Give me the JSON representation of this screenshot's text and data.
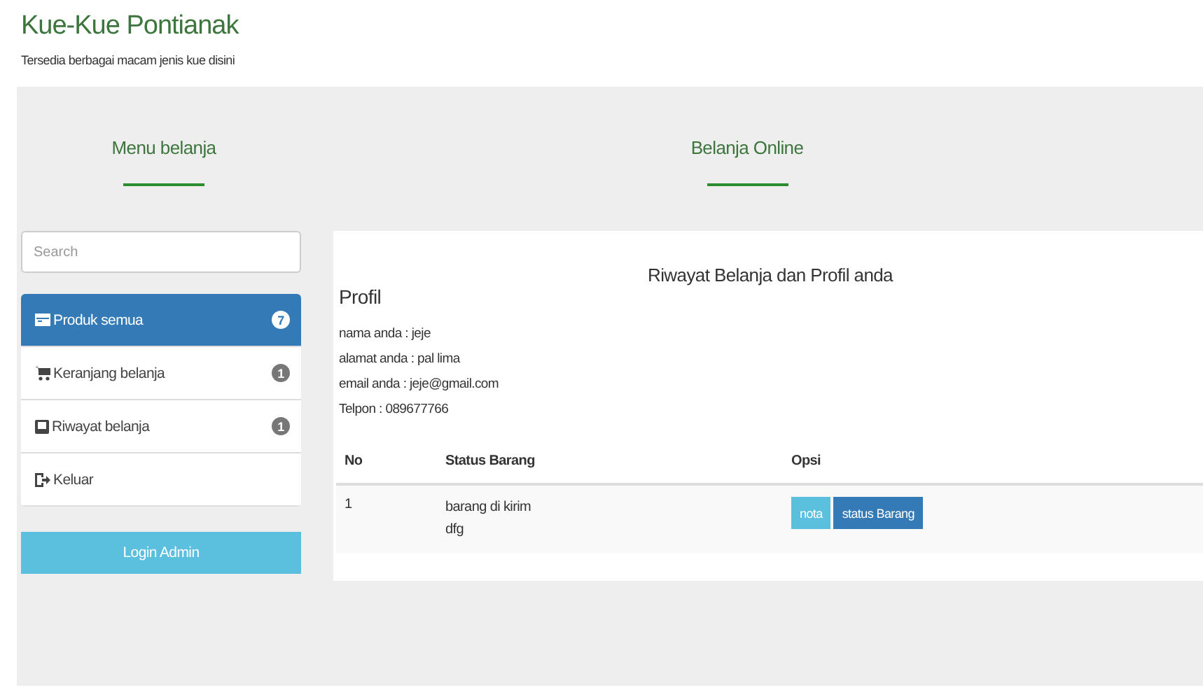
{
  "header": {
    "title": "Kue-Kue Pontianak",
    "subtitle": "Tersedia berbagai macam jenis kue disini"
  },
  "sidebar": {
    "heading": "Menu belanja",
    "search": {
      "placeholder": "Search"
    },
    "items": [
      {
        "label": "Produk semua",
        "badge": "7",
        "selected": true
      },
      {
        "label": "Keranjang belanja",
        "badge": "1",
        "selected": false
      },
      {
        "label": "Riwayat belanja",
        "badge": "1",
        "selected": false
      },
      {
        "label": "Keluar",
        "selected": false
      }
    ],
    "admin_button": "Login Admin"
  },
  "main": {
    "heading": "Belanja Online",
    "panel_title": "Riwayat Belanja dan Profil anda",
    "profile_heading": "Profil",
    "profile_lines": [
      "nama anda : jeje",
      "alamat anda : pal lima",
      "email anda : jeje@gmail.com",
      "Telpon : 089677766"
    ],
    "table": {
      "columns": [
        "No",
        "Status Barang",
        "Opsi"
      ],
      "rows": [
        {
          "no": "1",
          "status": [
            "barang di kirim",
            "dfg"
          ],
          "buttons": [
            {
              "label": "nota",
              "kind": "info"
            },
            {
              "label": "status Barang",
              "kind": "primary"
            }
          ]
        }
      ]
    }
  }
}
